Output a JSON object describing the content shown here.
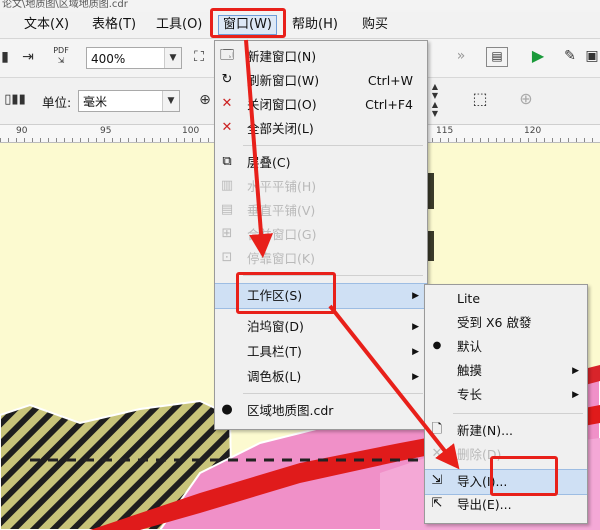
{
  "window": {
    "title_fragment": "论文\\地质图\\区域地质图.cdr"
  },
  "menubar": [
    {
      "label": "文本(X)"
    },
    {
      "label": "表格(T)"
    },
    {
      "label": "工具(O)"
    },
    {
      "label": "窗口(W)"
    },
    {
      "label": "帮助(H)"
    },
    {
      "label": "购买"
    }
  ],
  "toolbar": {
    "zoom_value": "400%",
    "pdf_label": "PDF",
    "unit_label": "单位:",
    "unit_value": "毫米"
  },
  "ruler": {
    "ticks": [
      "90",
      "95",
      "100",
      "115",
      "120"
    ]
  },
  "window_menu": {
    "items": [
      {
        "label": "新建窗口(N)",
        "shortcut": "",
        "icon": "new-window-icon",
        "disabled": false
      },
      {
        "label": "刷新窗口(W)",
        "shortcut": "Ctrl+W",
        "icon": "refresh-window-icon",
        "disabled": false
      },
      {
        "label": "关闭窗口(O)",
        "shortcut": "Ctrl+F4",
        "icon": "close-window-icon",
        "disabled": false
      },
      {
        "label": "全部关闭(L)",
        "shortcut": "",
        "icon": "close-all-icon",
        "disabled": false
      },
      {
        "label": "层叠(C)",
        "shortcut": "",
        "icon": "cascade-icon",
        "disabled": false
      },
      {
        "label": "水平平铺(H)",
        "shortcut": "",
        "icon": "tile-horizontal-icon",
        "disabled": true
      },
      {
        "label": "垂直平铺(V)",
        "shortcut": "",
        "icon": "tile-vertical-icon",
        "disabled": true
      },
      {
        "label": "合并窗口(G)",
        "shortcut": "",
        "icon": "combine-window-icon",
        "disabled": true
      },
      {
        "label": "停靠窗口(K)",
        "shortcut": "",
        "icon": "dock-window-icon",
        "disabled": true
      },
      {
        "label": "工作区(S)",
        "shortcut": "",
        "icon": "",
        "disabled": false,
        "submenu": true
      },
      {
        "label": "泊坞窗(D)",
        "shortcut": "",
        "icon": "",
        "disabled": false,
        "submenu": true
      },
      {
        "label": "工具栏(T)",
        "shortcut": "",
        "icon": "",
        "disabled": false,
        "submenu": true
      },
      {
        "label": "调色板(L)",
        "shortcut": "",
        "icon": "",
        "disabled": false,
        "submenu": true
      },
      {
        "label": "区域地质图.cdr",
        "shortcut": "",
        "icon": "",
        "disabled": false,
        "checked": true
      }
    ]
  },
  "workspace_menu": {
    "items": [
      {
        "label": "Lite"
      },
      {
        "label": "受到 X6 啟發"
      },
      {
        "label": "默认",
        "checked": true
      },
      {
        "label": "触摸",
        "submenu": true
      },
      {
        "label": "专长",
        "submenu": true
      },
      {
        "label": "新建(N)..."
      },
      {
        "label": "删除(D)"
      },
      {
        "label": "导入(I)..."
      },
      {
        "label": "导出(E)..."
      }
    ]
  },
  "colors": {
    "accent_red": "#e8201a",
    "highlight": "#cfe0f4",
    "canvas": "#fcfad0"
  }
}
